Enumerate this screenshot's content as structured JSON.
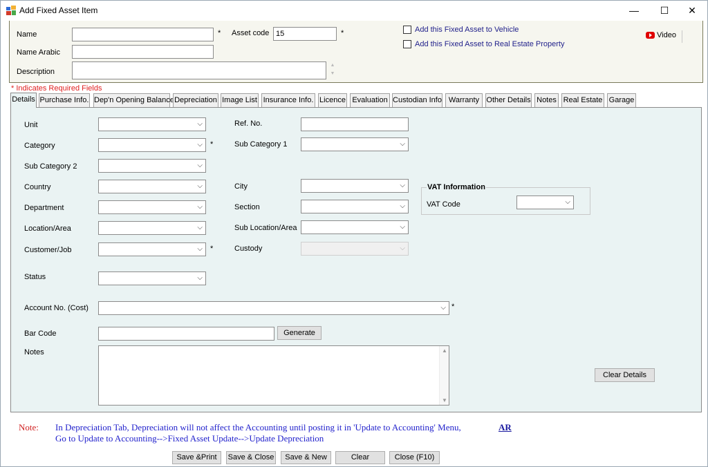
{
  "window": {
    "title": "Add Fixed Asset Item",
    "minimize": "—",
    "maximize": "☐",
    "close": "✕"
  },
  "header": {
    "name_label": "Name",
    "name_value": "",
    "name_arabic_label": "Name Arabic",
    "description_label": "Description",
    "asset_code_label": "Asset code",
    "asset_code_value": "15",
    "required_star": "*",
    "add_to_vehicle": "Add this Fixed Asset to Vehicle",
    "add_to_real_estate": "Add this Fixed Asset to Real Estate Property",
    "video_label": "Video"
  },
  "required_note": "* Indicates Required Fields",
  "tabs": [
    {
      "label": "Details",
      "active": true
    },
    {
      "label": "Purchase Info."
    },
    {
      "label": "Dep'n Opening Balance"
    },
    {
      "label": "Depreciation"
    },
    {
      "label": "Image List"
    },
    {
      "label": "Insurance Info."
    },
    {
      "label": "Licence"
    },
    {
      "label": "Evaluation"
    },
    {
      "label": "Custodian Info"
    },
    {
      "label": "Warranty"
    },
    {
      "label": "Other Details"
    },
    {
      "label": "Notes"
    },
    {
      "label": "Real Estate"
    },
    {
      "label": "Garage"
    }
  ],
  "details": {
    "unit": "Unit",
    "category": "Category",
    "sub_category_2": "Sub Category 2",
    "country": "Country",
    "department": "Department",
    "location_area": "Location/Area",
    "customer_job": "Customer/Job",
    "status": "Status",
    "ref_no": "Ref. No.",
    "sub_category_1": "Sub Category 1",
    "city": "City",
    "section": "Section",
    "sub_location_area": "Sub Location/Area",
    "custody": "Custody",
    "account_no_cost": "Account No. (Cost)",
    "bar_code": "Bar Code",
    "generate": "Generate",
    "notes": "Notes",
    "clear_details": "Clear Details",
    "vat_information": "VAT Information",
    "vat_code": "VAT Code"
  },
  "note": {
    "label": "Note:",
    "line1": "In Depreciation Tab, Depreciation will not affect the Accounting until posting it in 'Update to Accounting' Menu,",
    "line2": "Go to Update to Accounting-->Fixed Asset Update-->Update Depreciation",
    "ar_link": "AR"
  },
  "buttons": {
    "save_print": "Save &Print",
    "save_close": "Save & Close",
    "save_new": "Save & New",
    "clear": "Clear",
    "close": "Close (F10)"
  },
  "icons": {
    "dropdown_arrow": "chevron-down-icon",
    "video": "youtube-icon",
    "app": "app-icon"
  },
  "colors": {
    "tab_panel_bg": "#eaf3f3",
    "header_bg": "#f6f6ef",
    "required_red": "#e02020",
    "note_blue": "#2222cc"
  }
}
